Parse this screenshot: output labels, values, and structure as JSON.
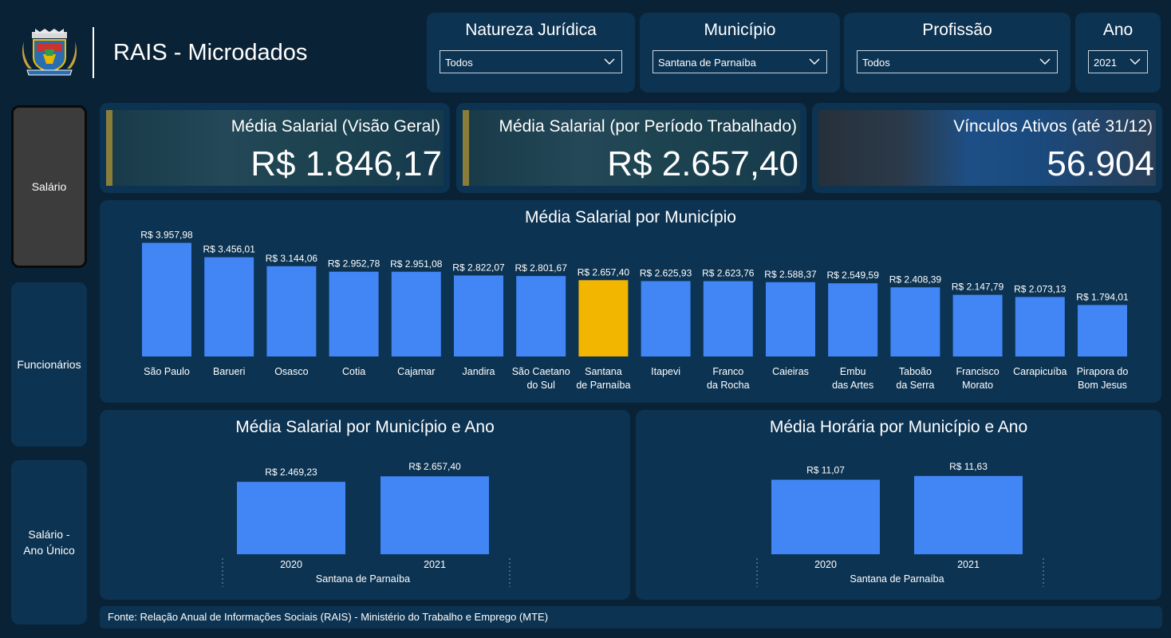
{
  "header": {
    "app_title": "RAIS - Microdados"
  },
  "filters": [
    {
      "title": "Natureza Jurídica",
      "value": "Todos"
    },
    {
      "title": "Município",
      "value": "Santana de Parnaíba"
    },
    {
      "title": "Profissão",
      "value": "Todos"
    },
    {
      "title": "Ano",
      "value": "2021"
    }
  ],
  "nav": [
    {
      "label": "Salário",
      "active": true
    },
    {
      "label": "Funcionários",
      "active": false
    },
    {
      "label": "Salário - Ano Único",
      "active": false
    }
  ],
  "kpis": [
    {
      "label": "Média Salarial (Visão Geral)",
      "value": "R$ 1.846,17"
    },
    {
      "label": "Média Salarial (por Período Trabalhado)",
      "value": "R$ 2.657,40"
    },
    {
      "label": "Vínculos Ativos (até 31/12)",
      "value": "56.904"
    }
  ],
  "colors": {
    "bar": "#4285f4",
    "highlight": "#f2b500",
    "panel": "#0c3352",
    "background": "#0a2236"
  },
  "chart_data": [
    {
      "type": "bar",
      "title": "Média Salarial por Município",
      "categories": [
        "São Paulo",
        "Barueri",
        "Osasco",
        "Cotia",
        "Cajamar",
        "Jandira",
        "São Caetano do Sul",
        "Santana de Parnaíba",
        "Itapevi",
        "Franco da Rocha",
        "Caieiras",
        "Embu das Artes",
        "Taboão da Serra",
        "Francisco Morato",
        "Carapicuíba",
        "Pirapora do Bom Jesus"
      ],
      "values": [
        3957.98,
        3456.01,
        3144.06,
        2952.78,
        2951.08,
        2822.07,
        2801.67,
        2657.4,
        2625.93,
        2623.76,
        2588.37,
        2549.59,
        2408.39,
        2147.79,
        2073.13,
        1794.01
      ],
      "data_labels": [
        "R$ 3.957,98",
        "R$ 3.456,01",
        "R$ 3.144,06",
        "R$ 2.952,78",
        "R$ 2.951,08",
        "R$ 2.822,07",
        "R$ 2.801,67",
        "R$ 2.657,40",
        "R$ 2.625,93",
        "R$ 2.623,76",
        "R$ 2.588,37",
        "R$ 2.549,59",
        "R$ 2.408,39",
        "R$ 2.147,79",
        "R$ 2.073,13",
        "R$ 1.794,01"
      ],
      "highlight": "Santana de Parnaíba",
      "ylim": [
        0,
        4000
      ]
    },
    {
      "type": "bar",
      "title": "Média Salarial por Município e Ano",
      "categories": [
        "2020",
        "2021"
      ],
      "values": [
        2469.23,
        2657.4
      ],
      "data_labels": [
        "R$ 2.469,23",
        "R$ 2.657,40"
      ],
      "group_label": "Santana de Parnaíba",
      "ylim": [
        0,
        2800
      ]
    },
    {
      "type": "bar",
      "title": "Média Horária por Município e Ano",
      "categories": [
        "2020",
        "2021"
      ],
      "values": [
        11.07,
        11.63
      ],
      "data_labels": [
        "R$ 11,07",
        "R$ 11,63"
      ],
      "group_label": "Santana de Parnaíba",
      "ylim": [
        0,
        12.2
      ]
    }
  ],
  "footer": {
    "source": "Fonte: Relação Anual de Informações Sociais (RAIS) - Ministério do Trabalho e Emprego (MTE)"
  }
}
